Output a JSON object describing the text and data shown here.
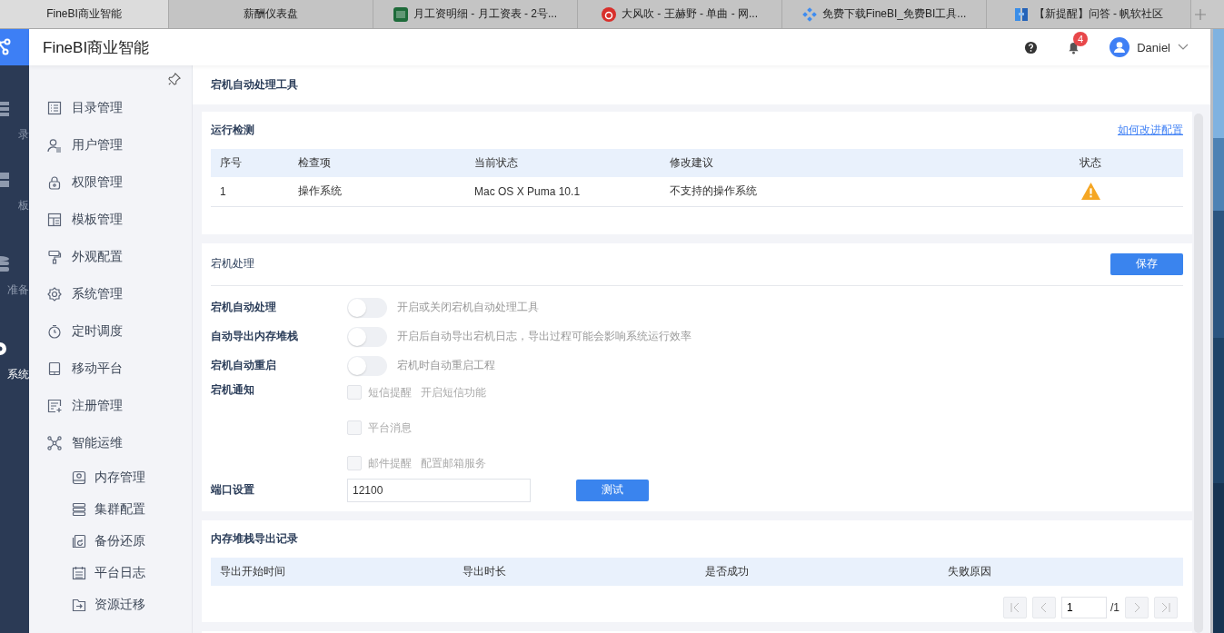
{
  "browser_tabs": [
    {
      "title": "FineBI商业智能",
      "selected": true
    },
    {
      "title": "薪酬仪表盘",
      "selected": false
    },
    {
      "title": "月工资明细 - 月工资表 - 2号...",
      "selected": false
    },
    {
      "title": "大风吹 - 王赫野 - 单曲 - 网...",
      "selected": false
    },
    {
      "title": "免费下载FineBI_免费BI工具...",
      "selected": false
    },
    {
      "title": "【新提醒】问答 - 帆软社区",
      "selected": false
    }
  ],
  "header": {
    "app_title": "FineBI商业智能",
    "notification_count": "4",
    "user": "Daniel"
  },
  "rail": [
    {
      "label": "录",
      "selected": false
    },
    {
      "label": "板",
      "selected": false
    },
    {
      "label": "准备",
      "selected": false
    },
    {
      "label": "系统",
      "selected": true
    }
  ],
  "sidebar": {
    "items": [
      {
        "label": "目录管理"
      },
      {
        "label": "用户管理"
      },
      {
        "label": "权限管理"
      },
      {
        "label": "模板管理"
      },
      {
        "label": "外观配置"
      },
      {
        "label": "系统管理"
      },
      {
        "label": "定时调度"
      },
      {
        "label": "移动平台"
      },
      {
        "label": "注册管理"
      },
      {
        "label": "智能运维",
        "children": [
          {
            "label": "内存管理"
          },
          {
            "label": "集群配置"
          },
          {
            "label": "备份还原"
          },
          {
            "label": "平台日志"
          },
          {
            "label": "资源迁移"
          }
        ]
      }
    ]
  },
  "page_title": "宕机自动处理工具",
  "run_check": {
    "title": "运行检测",
    "link": "如何改进配置",
    "columns": [
      "序号",
      "检查项",
      "当前状态",
      "修改建议",
      "状态"
    ],
    "rows": [
      {
        "cells": [
          "1",
          "操作系统",
          "Mac OS X Puma 10.1",
          "不支持的操作系统"
        ],
        "warning": true
      }
    ]
  },
  "crash_handling": {
    "title": "宕机处理",
    "save": "保存",
    "toggles": [
      {
        "label": "宕机自动处理",
        "on": false,
        "hint": "开启或关闭宕机自动处理工具"
      },
      {
        "label": "自动导出内存堆栈",
        "on": false,
        "hint": "开启后自动导出宕机日志，导出过程可能会影响系统运行效率"
      },
      {
        "label": "宕机自动重启",
        "on": false,
        "hint": "宕机时自动重启工程"
      }
    ],
    "notify_label": "宕机通知",
    "notify_options": [
      {
        "label": "短信提醒",
        "checked": false,
        "disabled": true,
        "link": "开启短信功能"
      },
      {
        "label": "平台消息",
        "checked": false,
        "disabled": true
      },
      {
        "label": "邮件提醒",
        "checked": false,
        "disabled": true,
        "link": "配置邮箱服务"
      }
    ],
    "port_label": "端口设置",
    "port_value": "12100",
    "test": "测试"
  },
  "dump_records": {
    "title": "内存堆栈导出记录",
    "columns": [
      "导出开始时间",
      "导出时长",
      "是否成功",
      "失败原因"
    ],
    "pagination": {
      "page": "1",
      "total": "/1"
    }
  }
}
